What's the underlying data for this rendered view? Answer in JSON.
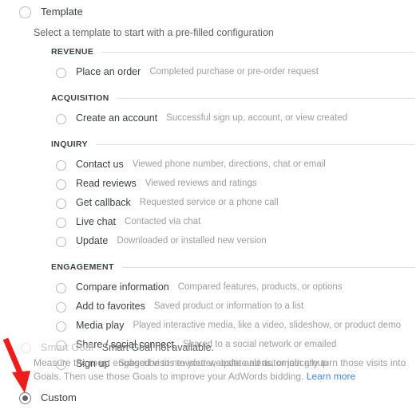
{
  "top_options": {
    "template": {
      "label": "Template",
      "selected": false,
      "description": "Select a template to start with a pre-filled configuration"
    },
    "smart_goal": {
      "label": "Smart Goal",
      "selected": false,
      "disabled": true,
      "note": "Smart Goal not available.",
      "body_before_link": "Measure the most engaged visits to your website and automatically turn those visits into Goals. Then use those Goals to improve your AdWords bidding. ",
      "link_label": "Learn more"
    },
    "custom": {
      "label": "Custom",
      "selected": true
    }
  },
  "sections": [
    {
      "title": "REVENUE",
      "options": [
        {
          "label": "Place an order",
          "description": "Completed purchase or pre-order request",
          "selected": false
        }
      ]
    },
    {
      "title": "ACQUISITION",
      "options": [
        {
          "label": "Create an account",
          "description": "Successful sign up, account, or view created",
          "selected": false
        }
      ]
    },
    {
      "title": "INQUIRY",
      "options": [
        {
          "label": "Contact us",
          "description": "Viewed phone number, directions, chat or email",
          "selected": false
        },
        {
          "label": "Read reviews",
          "description": "Viewed reviews and ratings",
          "selected": false
        },
        {
          "label": "Get callback",
          "description": "Requested service or a phone call",
          "selected": false
        },
        {
          "label": "Live chat",
          "description": "Contacted via chat",
          "selected": false
        },
        {
          "label": "Update",
          "description": "Downloaded or installed new version",
          "selected": false
        }
      ]
    },
    {
      "title": "ENGAGEMENT",
      "options": [
        {
          "label": "Compare information",
          "description": "Compared features, products, or options",
          "selected": false
        },
        {
          "label": "Add to favorites",
          "description": "Saved product or information to a list",
          "selected": false
        },
        {
          "label": "Media play",
          "description": "Played interactive media, like a video, slideshow, or product demo",
          "selected": false
        },
        {
          "label": "Share / social connect",
          "description": "Shared to a social network or emailed",
          "selected": false
        },
        {
          "label": "Sign up",
          "description": "Subscribe to newsletter, update alerts, or join group",
          "selected": false
        }
      ]
    }
  ],
  "annotation": {
    "arrow_color": "#ef1c1c",
    "points_to": "custom-radio"
  },
  "colors": {
    "link": "#4285f4",
    "text_primary": "#3c4043",
    "text_secondary": "#5f6368",
    "text_muted": "#9e9e9e",
    "rule": "#e0e0e0"
  }
}
